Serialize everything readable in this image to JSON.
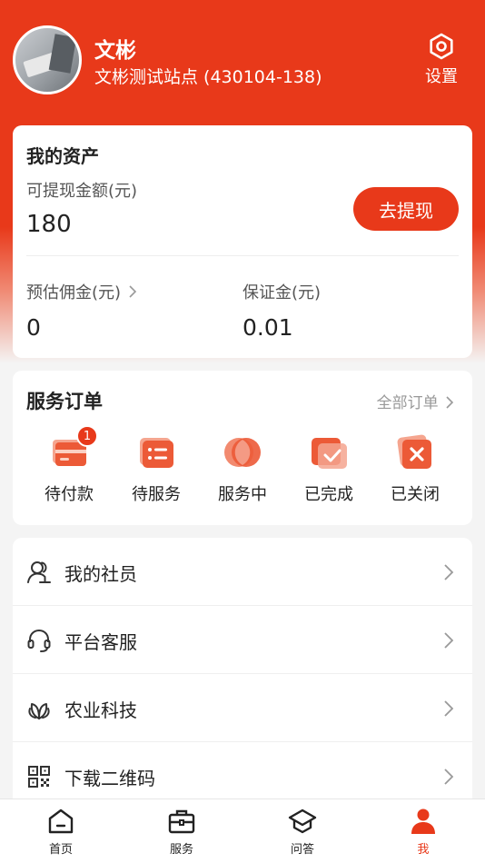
{
  "profile": {
    "name": "文彬",
    "station": "文彬测试站点 (430104-138)",
    "settings_label": "设置",
    "avatar_icon": "user-photo"
  },
  "assets": {
    "title": "我的资产",
    "withdrawable_label": "可提现金额(元)",
    "withdrawable_value": "180",
    "withdraw_button": "去提现",
    "commission_label": "预估佣金(元)",
    "commission_value": "0",
    "deposit_label": "保证金(元)",
    "deposit_value": "0.01"
  },
  "orders": {
    "title": "服务订单",
    "all_orders": "全部订单",
    "items": [
      {
        "label": "待付款",
        "icon": "card-icon",
        "badge": "1"
      },
      {
        "label": "待服务",
        "icon": "list-icon"
      },
      {
        "label": "服务中",
        "icon": "circles-icon"
      },
      {
        "label": "已完成",
        "icon": "check-icon"
      },
      {
        "label": "已关闭",
        "icon": "close-icon"
      }
    ]
  },
  "menu": [
    {
      "label": "我的社员",
      "icon": "members-icon"
    },
    {
      "label": "平台客服",
      "icon": "headset-icon"
    },
    {
      "label": "农业科技",
      "icon": "leaf-icon"
    },
    {
      "label": "下载二维码",
      "icon": "qrcode-icon"
    }
  ],
  "tabbar": [
    {
      "label": "首页",
      "icon": "home-icon"
    },
    {
      "label": "服务",
      "icon": "briefcase-icon"
    },
    {
      "label": "问答",
      "icon": "graduation-cap-icon"
    },
    {
      "label": "我",
      "icon": "person-icon",
      "active": true
    }
  ],
  "colors": {
    "brand": "#e8391a",
    "background": "#f4f4f4"
  }
}
